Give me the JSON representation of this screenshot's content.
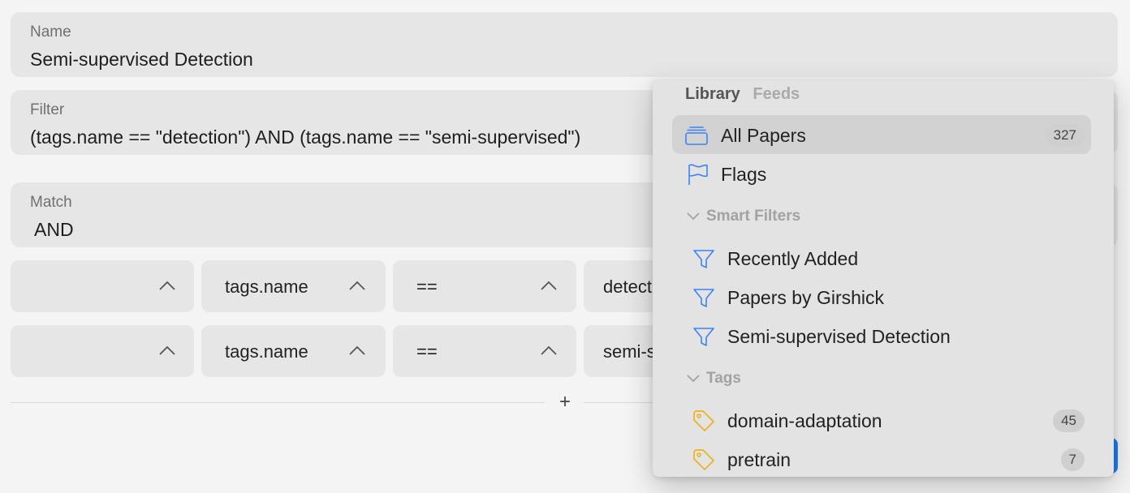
{
  "form": {
    "name_label": "Name",
    "name_value": "Semi-supervised Detection",
    "filter_label": "Filter",
    "filter_value": "(tags.name == \"detection\") AND (tags.name == \"semi-supervised\")",
    "match_label": "Match",
    "match_value": "AND"
  },
  "conditions": [
    {
      "prefix": "",
      "field": "tags.name",
      "operator": "==",
      "value": "detection"
    },
    {
      "prefix": "",
      "field": "tags.name",
      "operator": "==",
      "value": "semi-supervised"
    }
  ],
  "add_condition": "+",
  "dropdown": {
    "tabs": {
      "library": "Library",
      "feeds": "Feeds"
    },
    "all_papers": {
      "label": "All Papers",
      "count": "327"
    },
    "flags": {
      "label": "Flags"
    },
    "smart_filters_header": "Smart Filters",
    "smart_filters": [
      {
        "label": "Recently Added"
      },
      {
        "label": "Papers by Girshick"
      },
      {
        "label": "Semi-supervised Detection"
      }
    ],
    "tags_header": "Tags",
    "tags": [
      {
        "label": "domain-adaptation",
        "count": "45"
      },
      {
        "label": "pretrain",
        "count": "7"
      }
    ]
  },
  "colors": {
    "accent_blue": "#3b82f6",
    "tag_yellow": "#e9b320",
    "panel_bg": "#e3e3e3"
  }
}
